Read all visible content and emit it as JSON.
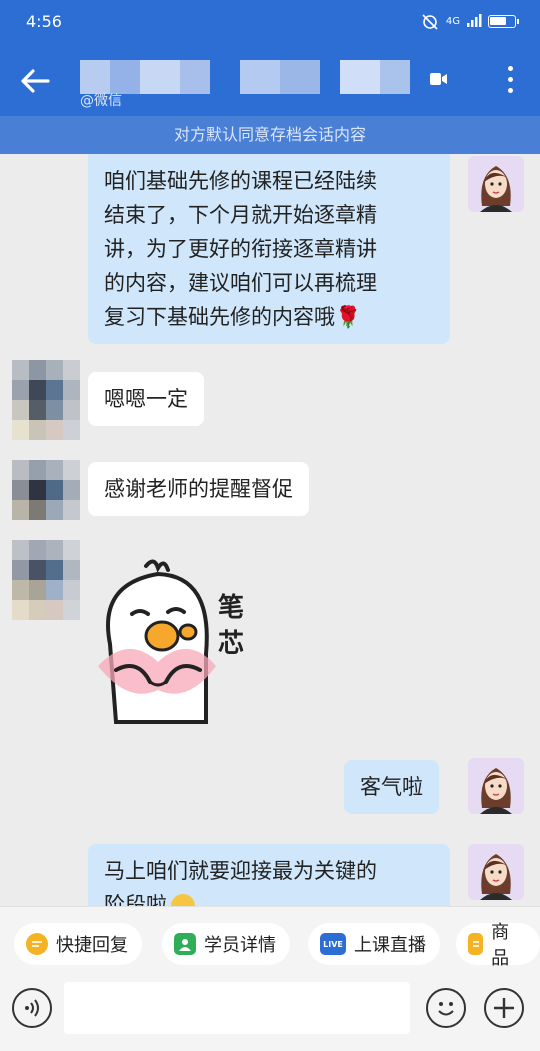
{
  "status_bar": {
    "time": "4:56",
    "network": "4G"
  },
  "header": {
    "subtitle": "@微信",
    "back_icon": "arrow-left-icon",
    "video_icon": "video-call-icon",
    "more_icon": "more-vertical-icon"
  },
  "notice": "对方默认同意存档会话内容",
  "messages": [
    {
      "side": "right",
      "lines": [
        "咱们基础先修的课程已经陆续",
        "结束了，下个月就开始逐章精",
        "讲，为了更好的衔接逐章精讲",
        "的内容，建议咱们可以再梳理",
        "复习下基础先修的内容哦🌹"
      ]
    },
    {
      "side": "left",
      "text": "嗯嗯一定"
    },
    {
      "side": "left",
      "text": "感谢老师的提醒督促"
    },
    {
      "side": "left",
      "sticker_text": "笔芯"
    },
    {
      "side": "right",
      "text": "客气啦"
    },
    {
      "side": "right",
      "lines": [
        "马上咱们就要迎接最为关键的",
        "阶段啦"
      ]
    }
  ],
  "quick_actions": [
    {
      "label": "快捷回复",
      "icon": "quick-reply-icon",
      "color": "#f5b324"
    },
    {
      "label": "学员详情",
      "icon": "student-detail-icon",
      "color": "#2fae5a"
    },
    {
      "label": "上课直播",
      "icon": "live-icon",
      "color": "#2d6ed4",
      "badge": "LIVE"
    },
    {
      "label": "商品",
      "icon": "product-icon",
      "color": "#f5b324"
    }
  ],
  "input_bar": {
    "voice_icon": "voice-icon",
    "emoji_icon": "emoji-icon",
    "plus_icon": "plus-icon"
  },
  "colors": {
    "header": "#2d6ed4",
    "bubble_right": "#cfe6fb",
    "bubble_left": "#ffffff",
    "background": "#ececec"
  }
}
